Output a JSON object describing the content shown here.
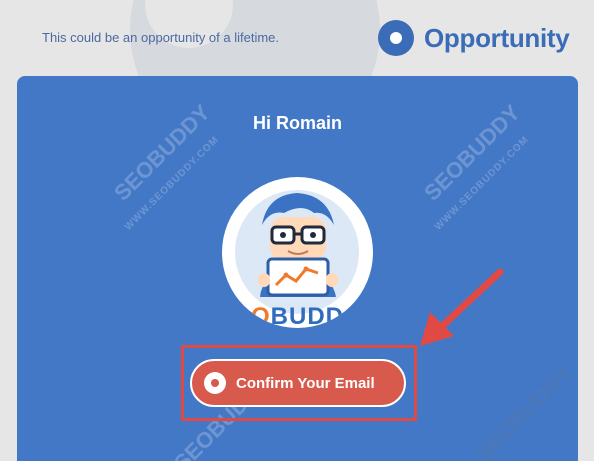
{
  "header": {
    "tagline": "This could be an opportunity of a lifetime.",
    "logo_text": "Opportunity",
    "logo_icon": "circle-dot-icon"
  },
  "card": {
    "greeting": "Hi Romain",
    "avatar_brand_pre": "",
    "avatar_brand_o": "O",
    "avatar_brand_post": "BUDD",
    "cta_label": "Confirm Your Email",
    "cta_icon": "circle-dot-icon"
  },
  "watermark": {
    "big": "SEOBUDDY",
    "small": "WWW.SEOBUDDY.COM"
  },
  "colors": {
    "background": "#e6e6e6",
    "card": "#4378c6",
    "brand": "#3b6cb8",
    "cta": "#d75a4d",
    "annotation": "#e14a44"
  }
}
